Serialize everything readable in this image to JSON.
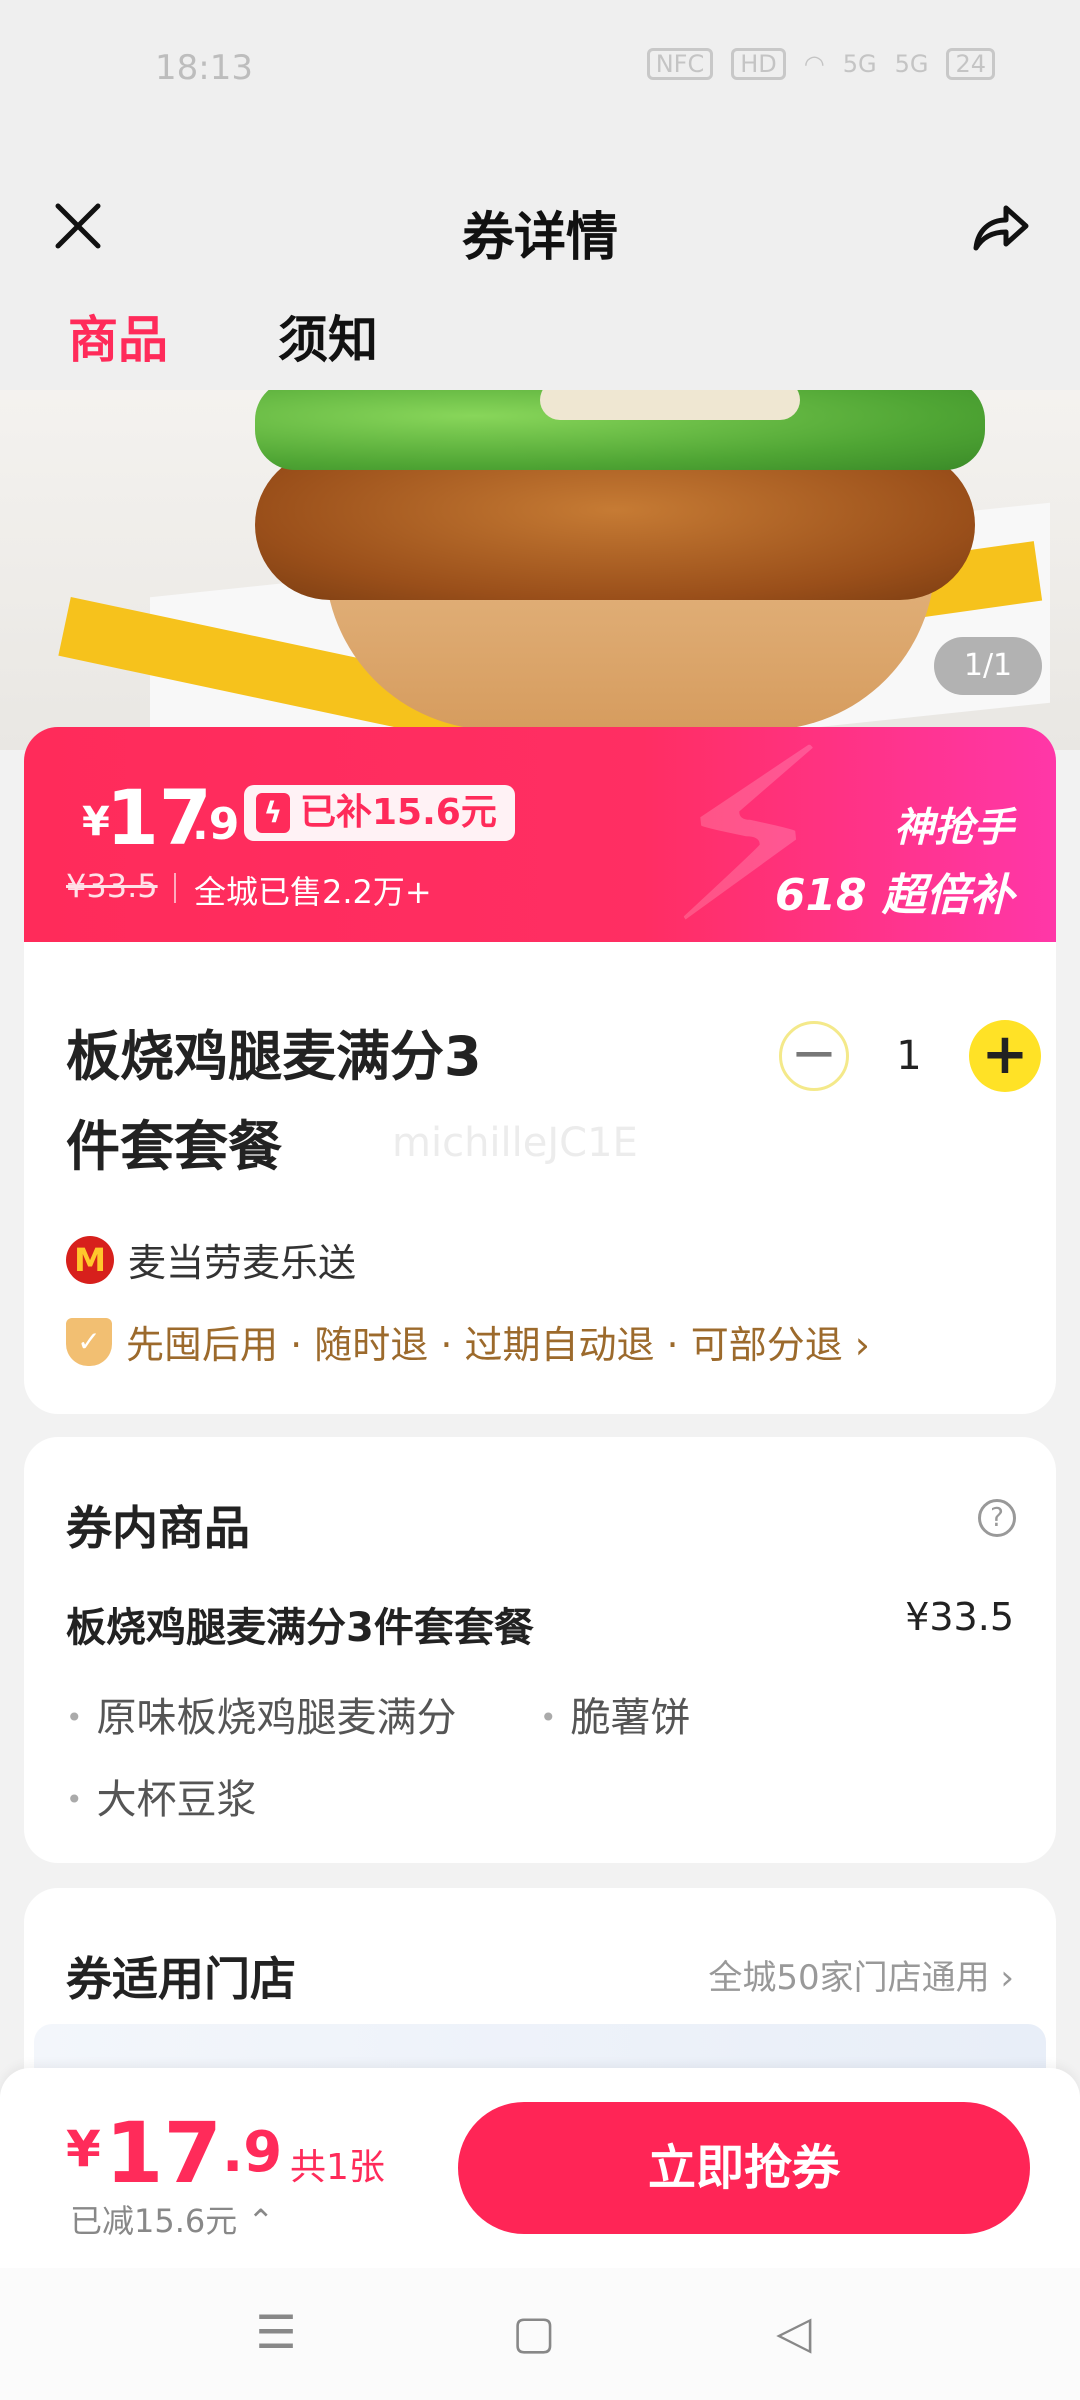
{
  "status": {
    "time": "18:13",
    "icons": [
      "NFC",
      "HD",
      "wifi",
      "5G",
      "5G"
    ],
    "battery": "24"
  },
  "header": {
    "title": "券详情",
    "close_icon": "close-icon",
    "share_icon": "share-icon"
  },
  "tabs": [
    {
      "label": "商品",
      "active": true
    },
    {
      "label": "须知",
      "active": false
    }
  ],
  "hero": {
    "page_indicator": "1/1"
  },
  "promo": {
    "currency": "¥",
    "price_int": "17",
    "price_dec": ".9",
    "subsidy": "已补15.6元",
    "original_price": "¥33.5",
    "sold": "全城已售2.2万+",
    "brand_line1": "神抢手",
    "brand_line2": "618 超倍补"
  },
  "product": {
    "name": "板烧鸡腿麦满分3件套套餐",
    "quantity": "1",
    "watermark": "michilleJC1E",
    "merchant": "麦当劳麦乐送",
    "policy": "先囤后用 · 随时退 · 过期自动退 · 可部分退 ›"
  },
  "items_section": {
    "title": "券内商品",
    "set_name": "板烧鸡腿麦满分3件套套餐",
    "set_price": "¥33.5",
    "items": [
      "原味板烧鸡腿麦满分",
      "脆薯饼",
      "大杯豆浆"
    ]
  },
  "store_section": {
    "title": "券适用门店",
    "link": "全城50家门店通用 ›"
  },
  "bottom_bar": {
    "currency": "¥",
    "price_int": "17",
    "price_dec": ".9",
    "count": "共1张",
    "saved": "已减15.6元 ⌃",
    "buy_label": "立即抢券"
  },
  "navbar": {
    "menu_icon": "☰",
    "home_icon": "▢",
    "back_icon": "◁"
  }
}
